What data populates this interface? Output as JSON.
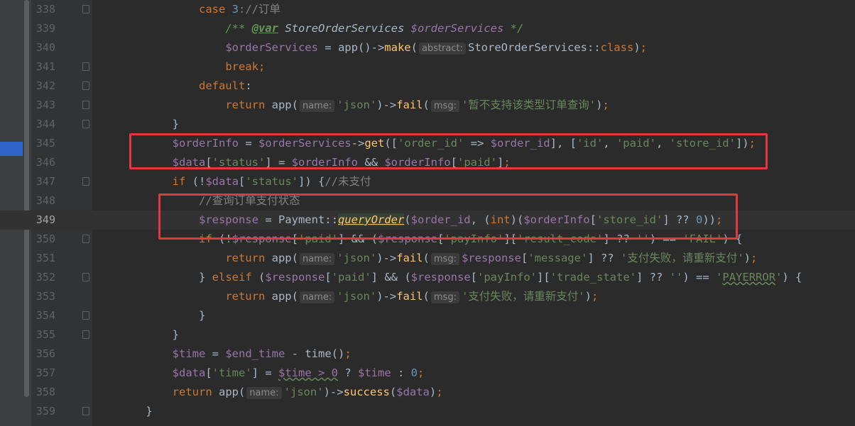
{
  "colors": {
    "keyword": "#cc7832",
    "string": "#6a8759",
    "number": "#6897bb",
    "variable": "#9876aa",
    "function": "#ffc66d",
    "comment": "#808080",
    "highlight_box": "#e4383f"
  },
  "lines": [
    {
      "no": "338",
      "tokens": [
        {
          "t": "            "
        },
        {
          "t": "case ",
          "c": "kw"
        },
        {
          "t": "3",
          "c": "num"
        },
        {
          "t": "://订单",
          "c": "cm"
        }
      ]
    },
    {
      "no": "339",
      "tokens": [
        {
          "t": "                "
        },
        {
          "t": "/** ",
          "c": "doc"
        },
        {
          "t": "@var",
          "c": "tag"
        },
        {
          "t": " "
        },
        {
          "t": "StoreOrderServices",
          "c": "cls"
        },
        {
          "t": " "
        },
        {
          "t": "$orderServices",
          "c": "dv"
        },
        {
          "t": " */",
          "c": "doc"
        }
      ]
    },
    {
      "no": "340",
      "tokens": [
        {
          "t": "                "
        },
        {
          "t": "$orderServices",
          "c": "var"
        },
        {
          "t": " = app()->"
        },
        {
          "t": "make",
          "c": "fn"
        },
        {
          "t": "("
        },
        {
          "t": "abstract:",
          "c": "hint"
        },
        {
          "t": "StoreOrderServices::"
        },
        {
          "t": "class",
          "c": "kw"
        },
        {
          "t": ")"
        },
        {
          "t": ";",
          "c": "kw"
        }
      ]
    },
    {
      "no": "341",
      "tokens": [
        {
          "t": "                "
        },
        {
          "t": "break;",
          "c": "kw"
        }
      ]
    },
    {
      "no": "342",
      "tokens": [
        {
          "t": "            "
        },
        {
          "t": "default",
          "c": "kw"
        },
        {
          "t": ":"
        }
      ]
    },
    {
      "no": "343",
      "tokens": [
        {
          "t": "                "
        },
        {
          "t": "return ",
          "c": "kw"
        },
        {
          "t": "app("
        },
        {
          "t": "name:",
          "c": "hint"
        },
        {
          "t": "'json'",
          "c": "str"
        },
        {
          "t": ")->"
        },
        {
          "t": "fail",
          "c": "fn"
        },
        {
          "t": "("
        },
        {
          "t": "msg:",
          "c": "hint"
        },
        {
          "t": "'暂不支持该类型订单查询'",
          "c": "str"
        },
        {
          "t": ")"
        },
        {
          "t": ";",
          "c": "kw"
        }
      ]
    },
    {
      "no": "344",
      "tokens": [
        {
          "t": "        }"
        }
      ]
    },
    {
      "no": "345",
      "tokens": [
        {
          "t": "        "
        },
        {
          "t": "$orderInfo",
          "c": "var"
        },
        {
          "t": " = "
        },
        {
          "t": "$orderServices",
          "c": "var"
        },
        {
          "t": "->"
        },
        {
          "t": "get",
          "c": "fn"
        },
        {
          "t": "(["
        },
        {
          "t": "'order_id'",
          "c": "str"
        },
        {
          "t": " => "
        },
        {
          "t": "$order_id",
          "c": "var"
        },
        {
          "t": "], ["
        },
        {
          "t": "'id'",
          "c": "str"
        },
        {
          "t": ", "
        },
        {
          "t": "'paid'",
          "c": "str"
        },
        {
          "t": ", "
        },
        {
          "t": "'store_id'",
          "c": "str"
        },
        {
          "t": "])"
        },
        {
          "t": ";",
          "c": "kw"
        }
      ]
    },
    {
      "no": "346",
      "tokens": [
        {
          "t": "        "
        },
        {
          "t": "$data",
          "c": "var"
        },
        {
          "t": "["
        },
        {
          "t": "'status'",
          "c": "str"
        },
        {
          "t": "] = "
        },
        {
          "t": "$orderInfo",
          "c": "var"
        },
        {
          "t": " && "
        },
        {
          "t": "$orderInfo",
          "c": "var"
        },
        {
          "t": "["
        },
        {
          "t": "'paid'",
          "c": "str"
        },
        {
          "t": "]"
        },
        {
          "t": ";",
          "c": "kw"
        }
      ]
    },
    {
      "no": "347",
      "tokens": [
        {
          "t": "        "
        },
        {
          "t": "if ",
          "c": "kw"
        },
        {
          "t": "(!"
        },
        {
          "t": "$data",
          "c": "var"
        },
        {
          "t": "["
        },
        {
          "t": "'status'",
          "c": "str"
        },
        {
          "t": "]) {"
        },
        {
          "t": "//未支付",
          "c": "cm"
        }
      ]
    },
    {
      "no": "348",
      "tokens": [
        {
          "t": "            "
        },
        {
          "t": "//查询订单支付状态",
          "c": "cm"
        }
      ]
    },
    {
      "no": "349",
      "caret": true,
      "tokens": [
        {
          "t": "            "
        },
        {
          "t": "$response",
          "c": "var"
        },
        {
          "t": " = Payment::"
        },
        {
          "t": "queryOrder",
          "c": "usg"
        },
        {
          "t": "("
        },
        {
          "t": "$order_id",
          "c": "var"
        },
        {
          "t": ", ("
        },
        {
          "t": "int",
          "c": "kw"
        },
        {
          "t": ")("
        },
        {
          "t": "$orderInfo",
          "c": "var"
        },
        {
          "t": "["
        },
        {
          "t": "'store_id'",
          "c": "str"
        },
        {
          "t": "] ?? "
        },
        {
          "t": "0",
          "c": "num"
        },
        {
          "t": "))"
        },
        {
          "t": ";",
          "c": "kw"
        }
      ]
    },
    {
      "no": "350",
      "tokens": [
        {
          "t": "            "
        },
        {
          "t": "if ",
          "c": "kw"
        },
        {
          "t": "(!"
        },
        {
          "t": "$response",
          "c": "var"
        },
        {
          "t": "["
        },
        {
          "t": "'paid'",
          "c": "str"
        },
        {
          "t": "] && ("
        },
        {
          "t": "$response",
          "c": "var"
        },
        {
          "t": "["
        },
        {
          "t": "'payInfo'",
          "c": "str"
        },
        {
          "t": "]["
        },
        {
          "t": "'result_code'",
          "c": "str"
        },
        {
          "t": "] ?? "
        },
        {
          "t": "''",
          "c": "str"
        },
        {
          "t": ") == "
        },
        {
          "t": "'FAIL'",
          "c": "str"
        },
        {
          "t": ") {"
        }
      ]
    },
    {
      "no": "351",
      "tokens": [
        {
          "t": "                "
        },
        {
          "t": "return ",
          "c": "kw"
        },
        {
          "t": "app("
        },
        {
          "t": "name:",
          "c": "hint"
        },
        {
          "t": "'json'",
          "c": "str"
        },
        {
          "t": ")->"
        },
        {
          "t": "fail",
          "c": "fn"
        },
        {
          "t": "("
        },
        {
          "t": "msg:",
          "c": "hint"
        },
        {
          "t": "$response",
          "c": "var"
        },
        {
          "t": "["
        },
        {
          "t": "'message'",
          "c": "str"
        },
        {
          "t": "] ?? "
        },
        {
          "t": "'支付失败，请重新支付'",
          "c": "str"
        },
        {
          "t": ")"
        },
        {
          "t": ";",
          "c": "kw"
        }
      ]
    },
    {
      "no": "352",
      "tokens": [
        {
          "t": "            } "
        },
        {
          "t": "elseif ",
          "c": "kw"
        },
        {
          "t": "("
        },
        {
          "t": "$response",
          "c": "var"
        },
        {
          "t": "["
        },
        {
          "t": "'paid'",
          "c": "str"
        },
        {
          "t": "] && ("
        },
        {
          "t": "$response",
          "c": "var"
        },
        {
          "t": "["
        },
        {
          "t": "'payInfo'",
          "c": "str"
        },
        {
          "t": "]["
        },
        {
          "t": "'trade_state'",
          "c": "str"
        },
        {
          "t": "] ?? "
        },
        {
          "t": "''",
          "c": "str"
        },
        {
          "t": ") == "
        },
        {
          "t": "'",
          "c": "str"
        },
        {
          "t": "PAYERROR",
          "c": "str wavy"
        },
        {
          "t": "'",
          "c": "str"
        },
        {
          "t": ") {"
        }
      ]
    },
    {
      "no": "353",
      "tokens": [
        {
          "t": "                "
        },
        {
          "t": "return ",
          "c": "kw"
        },
        {
          "t": "app("
        },
        {
          "t": "name:",
          "c": "hint"
        },
        {
          "t": "'json'",
          "c": "str"
        },
        {
          "t": ")->"
        },
        {
          "t": "fail",
          "c": "fn"
        },
        {
          "t": "("
        },
        {
          "t": "msg:",
          "c": "hint"
        },
        {
          "t": "'支付失败，请重新支付'",
          "c": "str"
        },
        {
          "t": ")"
        },
        {
          "t": ";",
          "c": "kw"
        }
      ]
    },
    {
      "no": "354",
      "tokens": [
        {
          "t": "            }"
        }
      ]
    },
    {
      "no": "355",
      "tokens": [
        {
          "t": "        }"
        }
      ]
    },
    {
      "no": "356",
      "tokens": [
        {
          "t": "        "
        },
        {
          "t": "$time",
          "c": "var"
        },
        {
          "t": " = "
        },
        {
          "t": "$end_time",
          "c": "var"
        },
        {
          "t": " - time()"
        },
        {
          "t": ";",
          "c": "kw"
        }
      ]
    },
    {
      "no": "357",
      "tokens": [
        {
          "t": "        "
        },
        {
          "t": "$data",
          "c": "var"
        },
        {
          "t": "["
        },
        {
          "t": "'time'",
          "c": "str"
        },
        {
          "t": "] = "
        },
        {
          "t": "$time > 0",
          "c": "var wavy"
        },
        {
          "t": " ? "
        },
        {
          "t": "$time",
          "c": "var"
        },
        {
          "t": " : "
        },
        {
          "t": "0",
          "c": "num"
        },
        {
          "t": ";",
          "c": "kw"
        }
      ]
    },
    {
      "no": "358",
      "tokens": [
        {
          "t": "        "
        },
        {
          "t": "return ",
          "c": "kw"
        },
        {
          "t": "app("
        },
        {
          "t": "name:",
          "c": "hint"
        },
        {
          "t": "'json'",
          "c": "str"
        },
        {
          "t": ")->"
        },
        {
          "t": "success",
          "c": "fn"
        },
        {
          "t": "("
        },
        {
          "t": "$data",
          "c": "var"
        },
        {
          "t": ")"
        },
        {
          "t": ";",
          "c": "kw"
        }
      ]
    },
    {
      "no": "359",
      "tokens": [
        {
          "t": "    }"
        }
      ]
    }
  ]
}
